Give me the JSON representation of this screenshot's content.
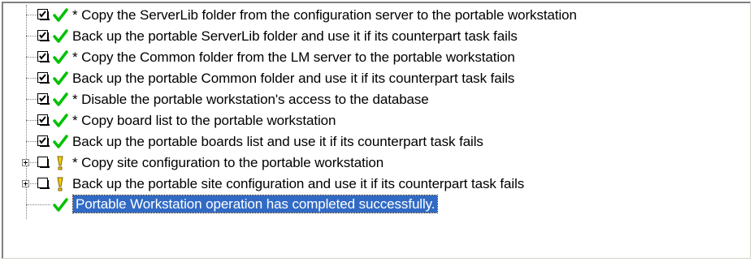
{
  "tree": {
    "items": [
      {
        "label": "* Copy the ServerLib folder from the configuration server to the portable workstation",
        "checked": true,
        "status": "success",
        "expandable": false
      },
      {
        "label": " Back up the portable ServerLib folder and use it if its counterpart task fails",
        "checked": true,
        "status": "success",
        "expandable": false
      },
      {
        "label": "* Copy the Common folder from the LM server to the portable workstation",
        "checked": true,
        "status": "success",
        "expandable": false
      },
      {
        "label": " Back up the portable Common folder and use it if its counterpart task fails",
        "checked": true,
        "status": "success",
        "expandable": false
      },
      {
        "label": "* Disable the portable workstation's access to the database",
        "checked": true,
        "status": "success",
        "expandable": false
      },
      {
        "label": "* Copy board list to the portable workstation",
        "checked": true,
        "status": "success",
        "expandable": false
      },
      {
        "label": " Back up the portable boards list and use it if its counterpart task fails",
        "checked": true,
        "status": "success",
        "expandable": false
      },
      {
        "label": "* Copy site configuration to the portable workstation",
        "checked": false,
        "status": "warning",
        "expandable": true
      },
      {
        "label": " Back up the portable site configuration and use it if its counterpart task fails",
        "checked": false,
        "status": "warning",
        "expandable": true
      }
    ],
    "final": {
      "label": "Portable Workstation operation has completed successfully.",
      "status": "success",
      "selected": true
    }
  },
  "colors": {
    "success": "#00c000",
    "warning": "#e0c000",
    "selection": "#316ac5"
  },
  "icons": {
    "success": "check-icon",
    "warning": "exclamation-icon"
  }
}
